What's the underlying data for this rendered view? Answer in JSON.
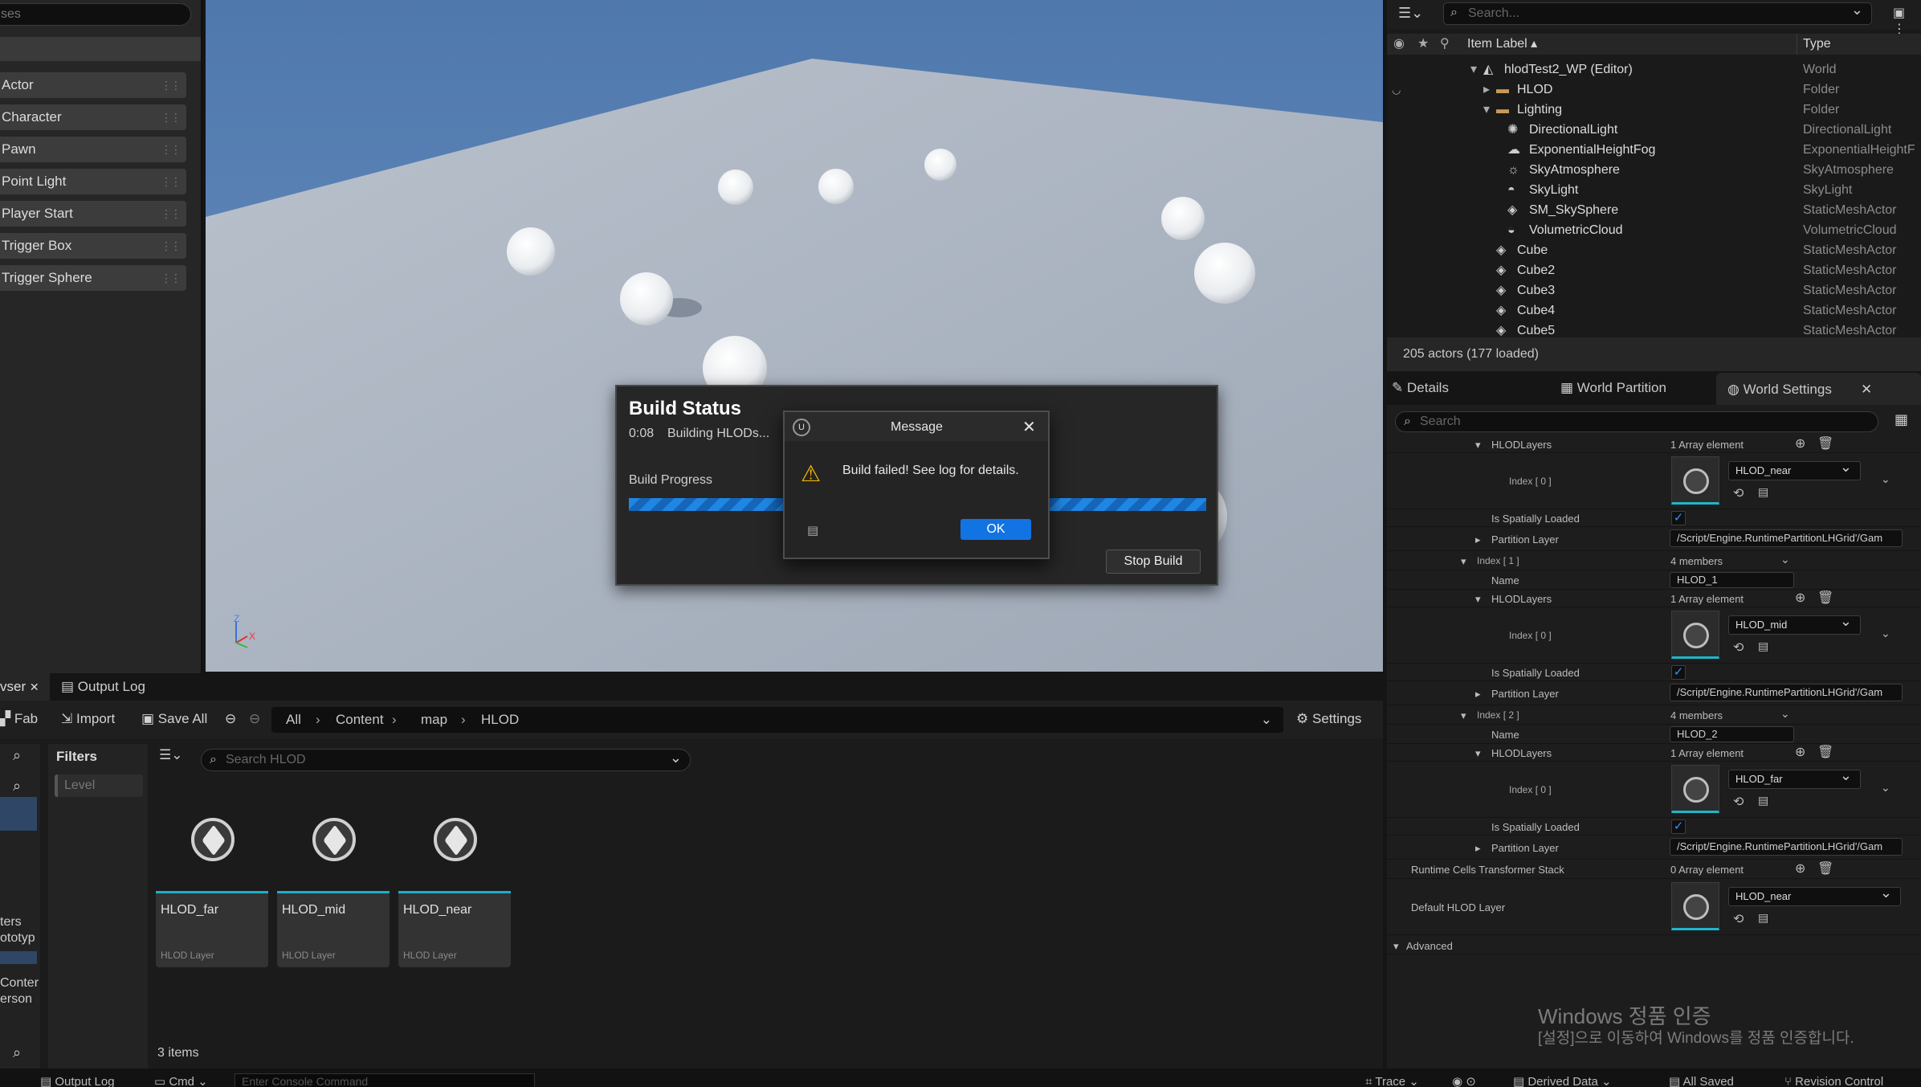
{
  "left_panel": {
    "search_placeholder": "ses",
    "place_items": [
      "Actor",
      "Character",
      "Pawn",
      "Point Light",
      "Player Start",
      "Trigger Box",
      "Trigger Sphere"
    ]
  },
  "viewport": {
    "axis_labels": {
      "z": "Z",
      "x": "X"
    }
  },
  "build_status": {
    "title": "Build Status",
    "elapsed": "0:08",
    "status_text": "Building HLODs...",
    "progress_label": "Build Progress",
    "stop_button": "Stop Build"
  },
  "message_dialog": {
    "title": "Message",
    "text": "Build failed! See log for details.",
    "ok_button": "OK"
  },
  "outliner": {
    "search_placeholder": "Search...",
    "col_label": "Item Label",
    "col_type": "Type",
    "rows": [
      {
        "label": "hlodTest2_WP (Editor)",
        "type": "World",
        "icon": "world-icon"
      },
      {
        "label": "HLOD",
        "type": "Folder",
        "icon": "folder-icon"
      },
      {
        "label": "Lighting",
        "type": "Folder",
        "icon": "folder-open-icon"
      },
      {
        "label": "DirectionalLight",
        "type": "DirectionalLight",
        "icon": "sun-icon"
      },
      {
        "label": "ExponentialHeightFog",
        "type": "ExponentialHeightF",
        "icon": "fog-icon"
      },
      {
        "label": "SkyAtmosphere",
        "type": "SkyAtmosphere",
        "icon": "sky-icon"
      },
      {
        "label": "SkyLight",
        "type": "SkyLight",
        "icon": "skylight-icon"
      },
      {
        "label": "SM_SkySphere",
        "type": "StaticMeshActor",
        "icon": "mesh-icon"
      },
      {
        "label": "VolumetricCloud",
        "type": "VolumetricCloud",
        "icon": "cloud-icon"
      },
      {
        "label": "Cube",
        "type": "StaticMeshActor",
        "icon": "mesh-icon"
      },
      {
        "label": "Cube2",
        "type": "StaticMeshActor",
        "icon": "mesh-icon"
      },
      {
        "label": "Cube3",
        "type": "StaticMeshActor",
        "icon": "mesh-icon"
      },
      {
        "label": "Cube4",
        "type": "StaticMeshActor",
        "icon": "mesh-icon"
      },
      {
        "label": "Cube5",
        "type": "StaticMeshActor",
        "icon": "mesh-icon"
      }
    ],
    "actor_count": "205 actors (177 loaded)"
  },
  "details": {
    "tabs": [
      "Details",
      "World Partition",
      "World Settings"
    ],
    "search_placeholder": "Search",
    "hlod_layers_label": "HLODLayers",
    "array_1": "1 Array element",
    "index_0": "Index [ 0 ]",
    "index_1": "Index [ 1 ]",
    "index_2": "Index [ 2 ]",
    "four_members": "4 members",
    "spatially_loaded": "Is Spatially Loaded",
    "partition_layer": "Partition Layer",
    "partition_value": "/Script/Engine.RuntimePartitionLHGrid'/Gam",
    "name_label": "Name",
    "name_1": "HLOD_1",
    "name_2": "HLOD_2",
    "layer_near": "HLOD_near",
    "layer_mid": "HLOD_mid",
    "layer_far": "HLOD_far",
    "transformer_label": "Runtime Cells Transformer Stack",
    "array_0": "0 Array element",
    "default_hlod_label": "Default HLOD Layer",
    "advanced_label": "Advanced"
  },
  "content_browser": {
    "tab_partial": "vser",
    "tab_output": "Output Log",
    "fab": "Fab",
    "import": "Import",
    "save_all": "Save All",
    "breadcrumb": [
      "All",
      "Content",
      "map",
      "HLOD"
    ],
    "settings": "Settings",
    "filters": "Filters",
    "level_chip": "Level",
    "search_placeholder": "Search HLOD",
    "left_tree_partial": [
      "ters",
      "ototyp",
      "Conter",
      "erson"
    ],
    "assets": [
      {
        "name": "HLOD_far",
        "type": "HLOD Layer"
      },
      {
        "name": "HLOD_mid",
        "type": "HLOD Layer"
      },
      {
        "name": "HLOD_near",
        "type": "HLOD Layer"
      }
    ],
    "item_count": "3 items"
  },
  "bottom_bar": {
    "output_log": "Output Log",
    "cmd": "Cmd",
    "console_placeholder": "Enter Console Command",
    "trace": "Trace",
    "derived_data": "Derived Data",
    "all_saved": "All Saved",
    "revision_control": "Revision Control"
  },
  "watermark": {
    "line1": "Windows 정품 인증",
    "line2": "[설정]으로 이동하여 Windows를 정품 인증합니다."
  }
}
